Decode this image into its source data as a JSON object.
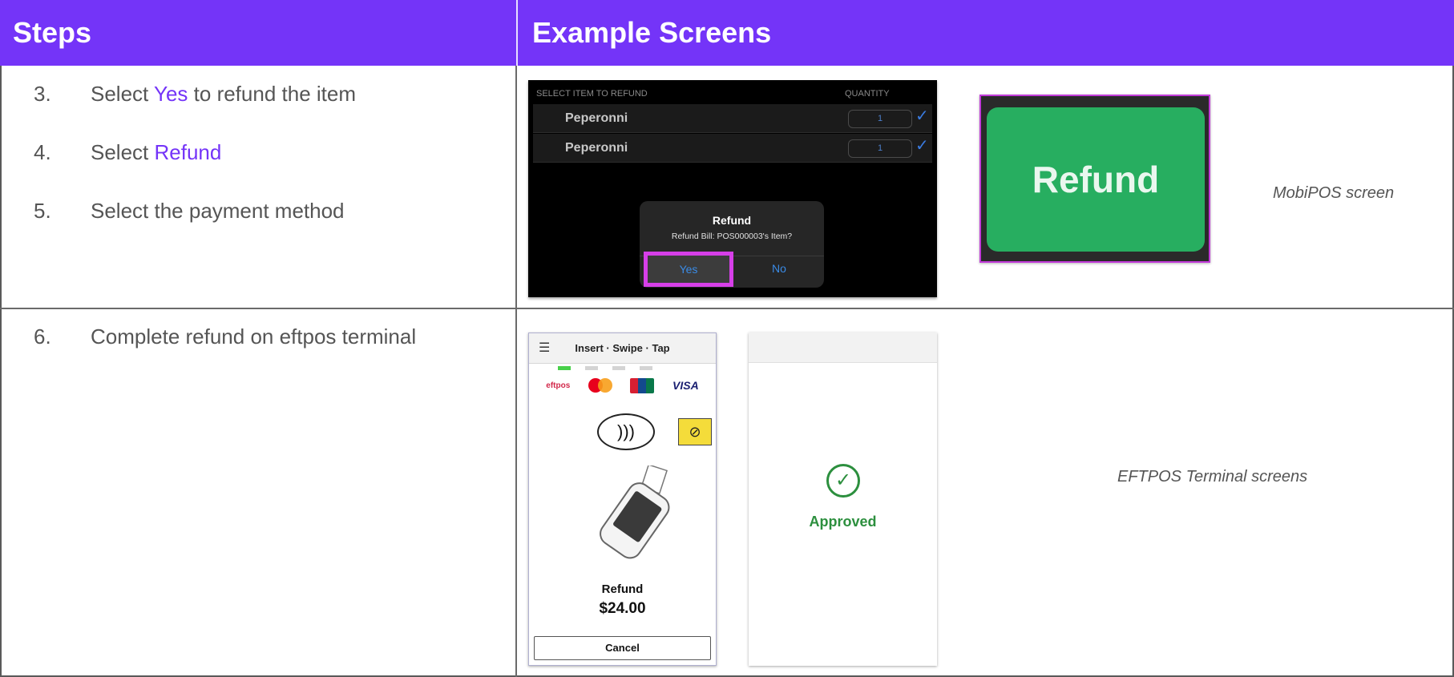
{
  "header": {
    "steps": "Steps",
    "examples": "Example Screens"
  },
  "steps": [
    {
      "num": "3.",
      "pre": "Select ",
      "accent": "Yes",
      "post": " to refund the item"
    },
    {
      "num": "4.",
      "pre": "Select ",
      "accent": "Refund",
      "post": ""
    },
    {
      "num": "5.",
      "pre": "Select the payment method",
      "accent": "",
      "post": ""
    },
    {
      "num": "6.",
      "pre": "Complete refund on eftpos terminal",
      "accent": "",
      "post": ""
    }
  ],
  "pos_screen": {
    "col_item": "SELECT ITEM TO REFUND",
    "col_qty": "QUANTITY",
    "rows": [
      {
        "name": "Peperonni",
        "qty": "1"
      },
      {
        "name": "Peperonni",
        "qty": "1"
      }
    ],
    "dialog": {
      "title": "Refund",
      "message": "Refund Bill: POS000003's Item?",
      "yes": "Yes",
      "no": "No"
    }
  },
  "refund_button": {
    "label": "Refund"
  },
  "captions": {
    "mobipos": "MobiPOS screen",
    "eftpos": "EFTPOS Terminal screens"
  },
  "eftpos_screen": {
    "title": "Insert · Swipe · Tap",
    "brand": "eftpos",
    "visa": "VISA",
    "label": "Refund",
    "amount": "$24.00",
    "cancel": "Cancel"
  },
  "approved_screen": {
    "status": "Approved"
  },
  "colors": {
    "accent": "#7434f8",
    "highlight": "#d63fe8",
    "green": "#27ae60"
  }
}
